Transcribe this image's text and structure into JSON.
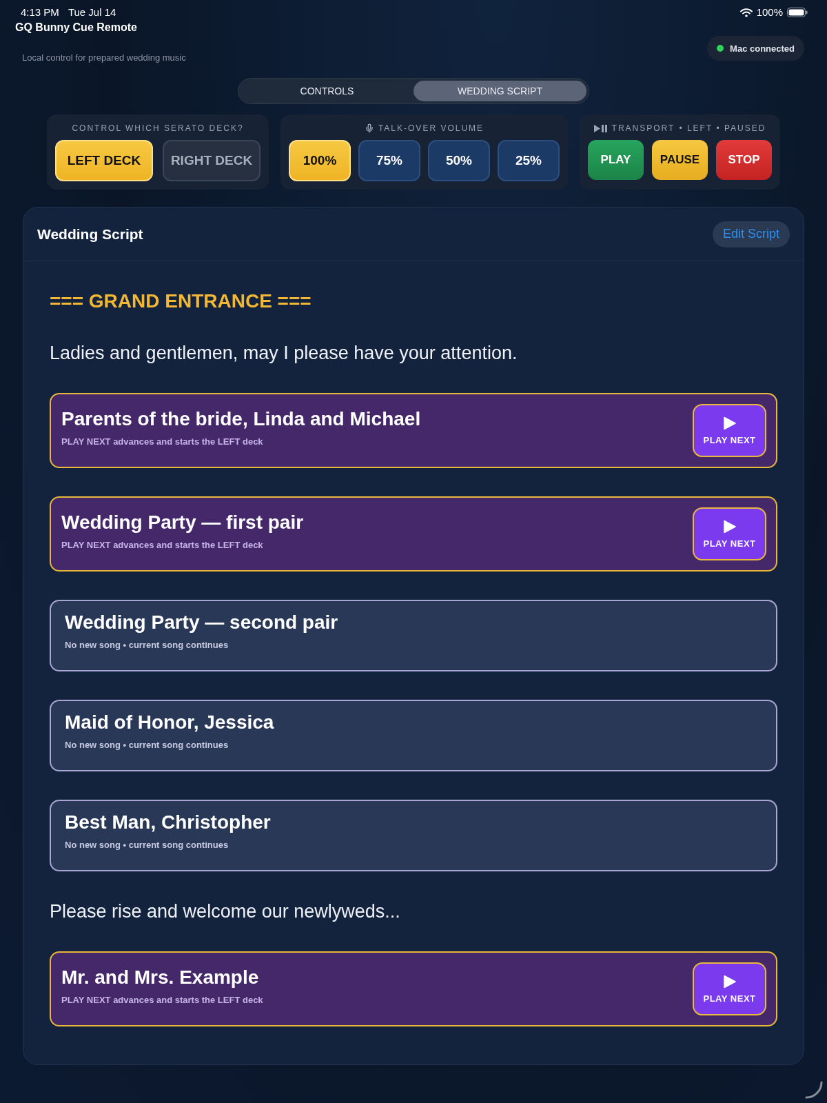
{
  "status_bar": {
    "time": "4:13 PM",
    "date": "Tue Jul 14",
    "battery": "100%"
  },
  "app_title": "GQ Bunny Cue Remote",
  "header": {
    "subtitle": "Local control for prepared wedding music",
    "connection": {
      "label": "Mac connected",
      "connected": true
    }
  },
  "tabs": [
    {
      "label": "CONTROLS",
      "selected": false
    },
    {
      "label": "WEDDING SCRIPT",
      "selected": true
    }
  ],
  "deck_panel": {
    "title": "CONTROL WHICH SERATO DECK?",
    "decks": [
      {
        "label": "LEFT DECK",
        "selected": true
      },
      {
        "label": "RIGHT DECK",
        "selected": false
      }
    ]
  },
  "volume_panel": {
    "title": "TALK-OVER VOLUME",
    "levels": [
      {
        "label": "100%",
        "selected": true
      },
      {
        "label": "75%",
        "selected": false
      },
      {
        "label": "50%",
        "selected": false
      },
      {
        "label": "25%",
        "selected": false
      }
    ]
  },
  "transport_panel": {
    "title": "TRANSPORT",
    "status": "• LEFT • PAUSED",
    "buttons": [
      {
        "label": "PLAY",
        "kind": "play"
      },
      {
        "label": "PAUSE",
        "kind": "pause"
      },
      {
        "label": "STOP",
        "kind": "stop"
      }
    ]
  },
  "script": {
    "title": "Wedding Script",
    "edit_button": "Edit Script",
    "items": [
      {
        "kind": "heading",
        "text": "=== GRAND ENTRANCE ==="
      },
      {
        "kind": "line",
        "text": "Ladies and gentlemen, may I please have your attention."
      },
      {
        "kind": "song",
        "title": "Parents of the bride, Linda and Michael",
        "note": "PLAY NEXT advances and starts the LEFT deck",
        "button": "PLAY NEXT"
      },
      {
        "kind": "song",
        "title": "Wedding Party — first pair",
        "note": "PLAY NEXT advances and starts the LEFT deck",
        "button": "PLAY NEXT"
      },
      {
        "kind": "announcement",
        "title": "Wedding Party — second pair",
        "note": "No new song • current song continues"
      },
      {
        "kind": "announcement",
        "title": "Maid of Honor, Jessica",
        "note": "No new song • current song continues"
      },
      {
        "kind": "announcement",
        "title": "Best Man, Christopher",
        "note": "No new song • current song continues"
      },
      {
        "kind": "line",
        "text": "Please rise and welcome our newlyweds..."
      },
      {
        "kind": "song",
        "title": "Mr. and Mrs. Example",
        "note": "PLAY NEXT advances and starts the LEFT deck",
        "button": "PLAY NEXT"
      }
    ]
  }
}
